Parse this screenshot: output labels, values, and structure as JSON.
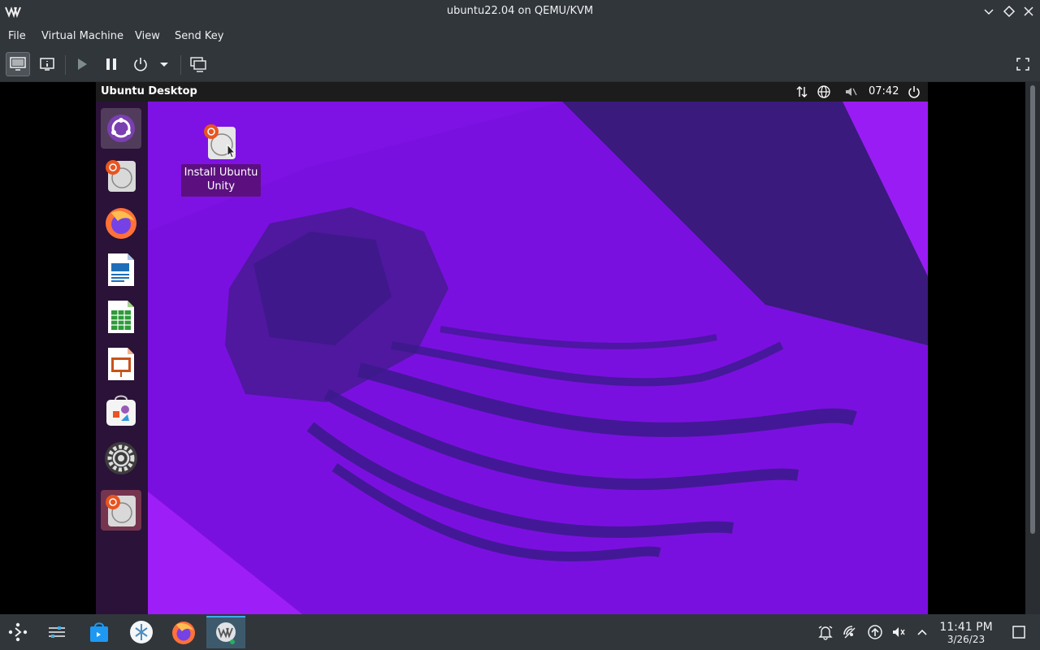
{
  "window": {
    "title": "ubuntu22.04 on QEMU/KVM"
  },
  "menubar": {
    "items": [
      "File",
      "Virtual Machine",
      "View",
      "Send Key"
    ]
  },
  "toolbar": {
    "buttons": [
      "console-icon",
      "details-icon",
      "play-icon",
      "pause-icon",
      "power-icon",
      "power-menu-chevron-icon",
      "snapshots-icon",
      "fullscreen-icon"
    ]
  },
  "guest": {
    "topbar": {
      "title": "Ubuntu Desktop",
      "time": "07:42"
    },
    "dock": {
      "items": [
        "ubuntu-logo-icon",
        "install-ubuntu-icon",
        "firefox-icon",
        "writer-icon",
        "calc-icon",
        "impress-icon",
        "software-icon",
        "settings-icon",
        "install-ubuntu-running-icon"
      ]
    },
    "desktop_icon": {
      "label": "Install Ubuntu Unity"
    }
  },
  "taskbar": {
    "apps": [
      "launcher-icon",
      "settings-panel-icon",
      "discover-icon",
      "virt-manager-icon",
      "firefox-icon",
      "vm-window-icon"
    ],
    "tray": [
      "notifications-icon",
      "network-icon",
      "updates-icon",
      "volume-icon",
      "expand-tray-icon"
    ],
    "clock": {
      "time": "11:41 PM",
      "date": "3/26/23"
    }
  },
  "colors": {
    "host_bg": "#31363b",
    "wallpaper_purple": "#7b12e0",
    "dock_bg": "#2b1238",
    "accent": "#3daee9"
  }
}
